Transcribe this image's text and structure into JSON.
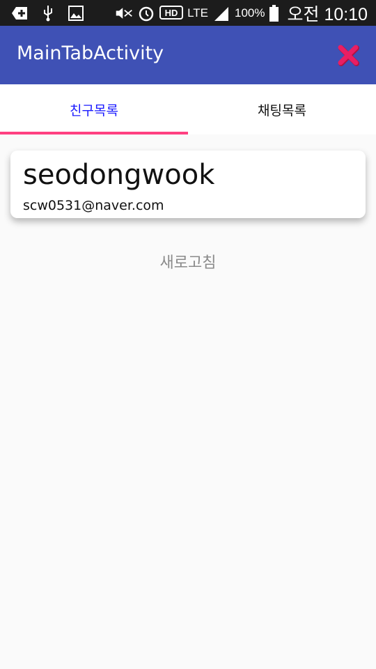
{
  "status_bar": {
    "battery": "100%",
    "network": "LTE",
    "am_pm": "오전",
    "time": "10:10"
  },
  "app_bar": {
    "title": "MainTabActivity",
    "close_icon": "close-icon",
    "accent": "#e91e63",
    "background": "#3f51b5"
  },
  "tabs": [
    {
      "label": "친구목록",
      "selected": true
    },
    {
      "label": "채팅목록",
      "selected": false
    }
  ],
  "tab_indicator_color": "#ff4081",
  "friends": [
    {
      "name": "seodongwook",
      "email": "scw0531@naver.com"
    }
  ],
  "refresh_label": "새로고침"
}
